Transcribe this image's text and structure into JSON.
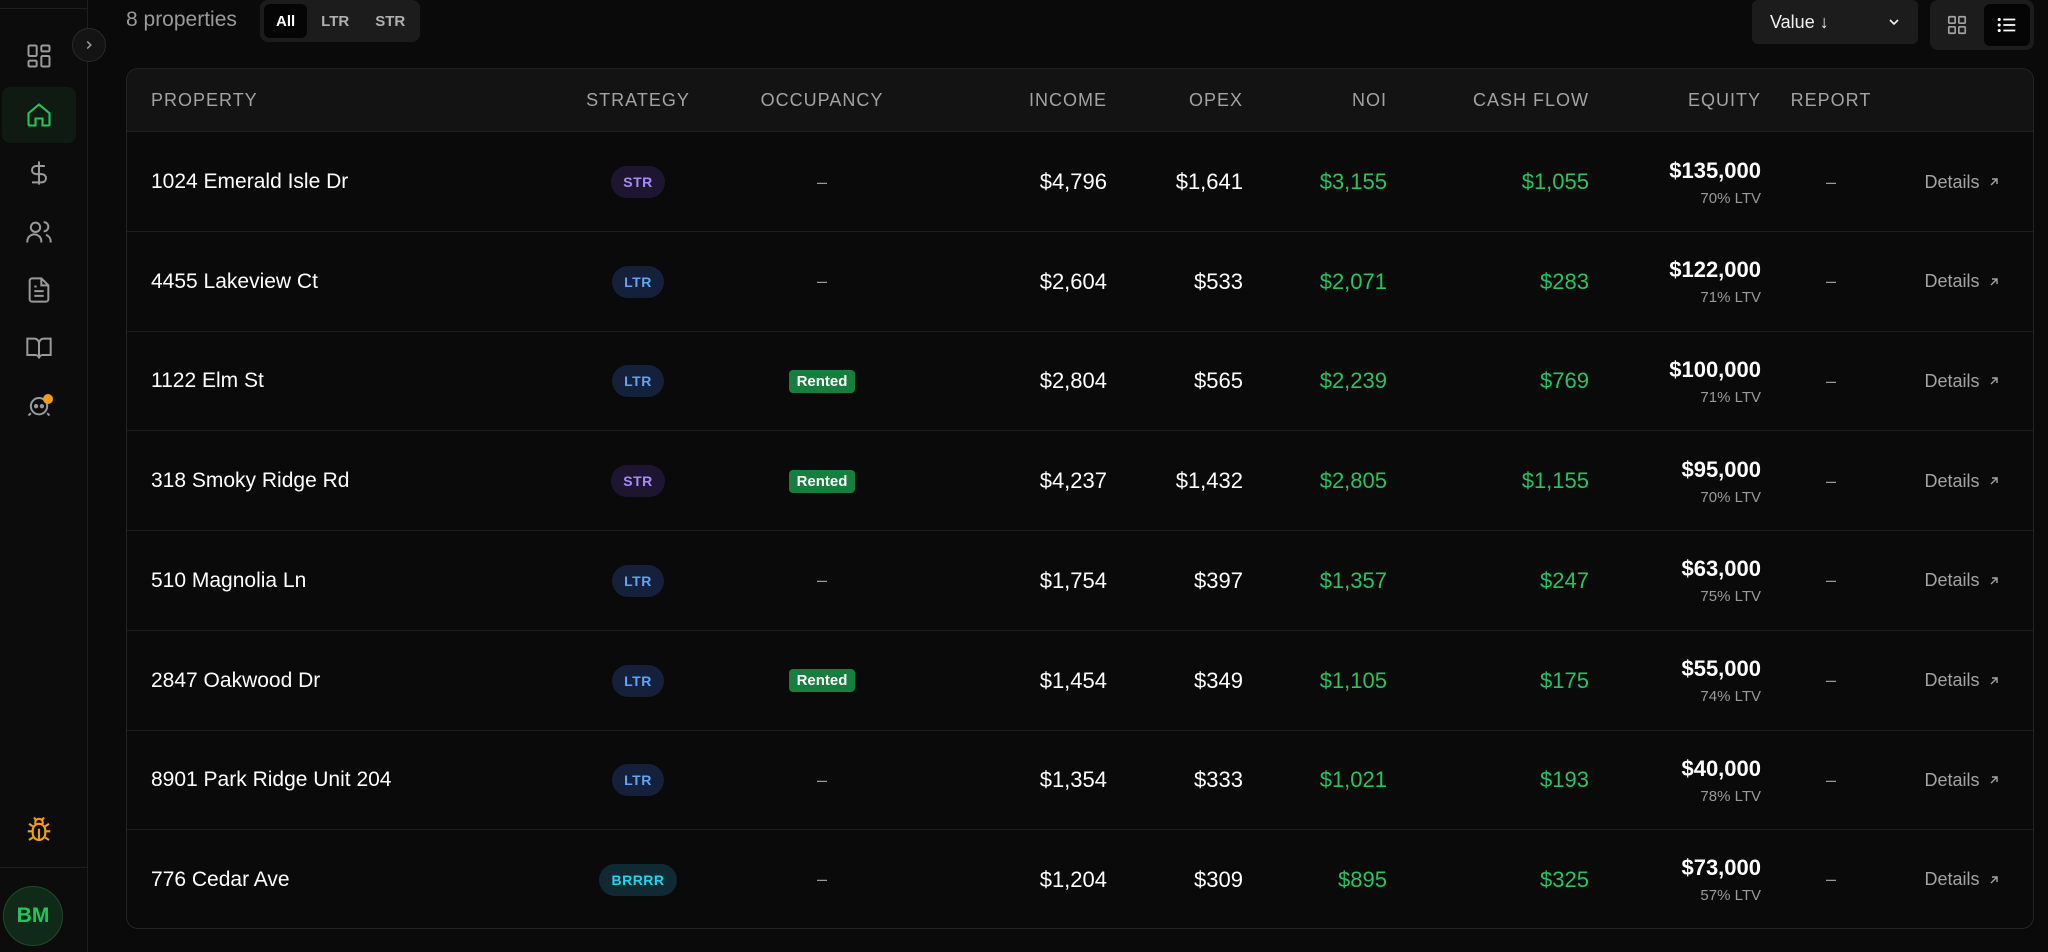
{
  "sidebar": {
    "icons": [
      "dashboard-icon",
      "home-icon",
      "dollar-icon",
      "users-icon",
      "document-icon",
      "book-open-icon",
      "bot-icon"
    ],
    "bug_icon": "bug-icon",
    "avatar_initials": "BM",
    "notification_color": "#f59e0b"
  },
  "toolbar": {
    "count_label": "8 properties",
    "filters": [
      "All",
      "LTR",
      "STR"
    ],
    "active_filter": "All",
    "sort_label": "Value ↓",
    "views": [
      "grid-icon",
      "list-icon"
    ],
    "active_view": "list"
  },
  "table": {
    "headers": {
      "property": "PROPERTY",
      "strategy": "STRATEGY",
      "occupancy": "OCCUPANCY",
      "income": "INCOME",
      "opex": "OPEX",
      "noi": "NOI",
      "cashflow": "CASH FLOW",
      "equity": "EQUITY",
      "report": "REPORT"
    },
    "rows": [
      {
        "address": "1024 Emerald Isle Dr",
        "strategy": "STR",
        "occupancy": "–",
        "income": "$4,796",
        "opex": "$1,641",
        "noi": "$3,155",
        "cashflow": "$1,055",
        "equity": "$135,000",
        "ltv": "70% LTV",
        "report": "–",
        "details": "Details"
      },
      {
        "address": "4455 Lakeview Ct",
        "strategy": "LTR",
        "occupancy": "–",
        "income": "$2,604",
        "opex": "$533",
        "noi": "$2,071",
        "cashflow": "$283",
        "equity": "$122,000",
        "ltv": "71% LTV",
        "report": "–",
        "details": "Details"
      },
      {
        "address": "1122 Elm St",
        "strategy": "LTR",
        "occupancy": "Rented",
        "income": "$2,804",
        "opex": "$565",
        "noi": "$2,239",
        "cashflow": "$769",
        "equity": "$100,000",
        "ltv": "71% LTV",
        "report": "–",
        "details": "Details"
      },
      {
        "address": "318 Smoky Ridge Rd",
        "strategy": "STR",
        "occupancy": "Rented",
        "income": "$4,237",
        "opex": "$1,432",
        "noi": "$2,805",
        "cashflow": "$1,155",
        "equity": "$95,000",
        "ltv": "70% LTV",
        "report": "–",
        "details": "Details"
      },
      {
        "address": "510 Magnolia Ln",
        "strategy": "LTR",
        "occupancy": "–",
        "income": "$1,754",
        "opex": "$397",
        "noi": "$1,357",
        "cashflow": "$247",
        "equity": "$63,000",
        "ltv": "75% LTV",
        "report": "–",
        "details": "Details"
      },
      {
        "address": "2847 Oakwood Dr",
        "strategy": "LTR",
        "occupancy": "Rented",
        "income": "$1,454",
        "opex": "$349",
        "noi": "$1,105",
        "cashflow": "$175",
        "equity": "$55,000",
        "ltv": "74% LTV",
        "report": "–",
        "details": "Details"
      },
      {
        "address": "8901 Park Ridge Unit 204",
        "strategy": "LTR",
        "occupancy": "–",
        "income": "$1,354",
        "opex": "$333",
        "noi": "$1,021",
        "cashflow": "$193",
        "equity": "$40,000",
        "ltv": "78% LTV",
        "report": "–",
        "details": "Details"
      },
      {
        "address": "776 Cedar Ave",
        "strategy": "BRRRR",
        "occupancy": "–",
        "income": "$1,204",
        "opex": "$309",
        "noi": "$895",
        "cashflow": "$325",
        "equity": "$73,000",
        "ltv": "57% LTV",
        "report": "–",
        "details": "Details"
      }
    ]
  },
  "colors": {
    "accent_green": "#22c55e",
    "str_badge": "#a78bfa",
    "ltr_badge": "#60a5fa",
    "brrrr_badge": "#22d3ee",
    "rented_badge": "#15803d"
  }
}
